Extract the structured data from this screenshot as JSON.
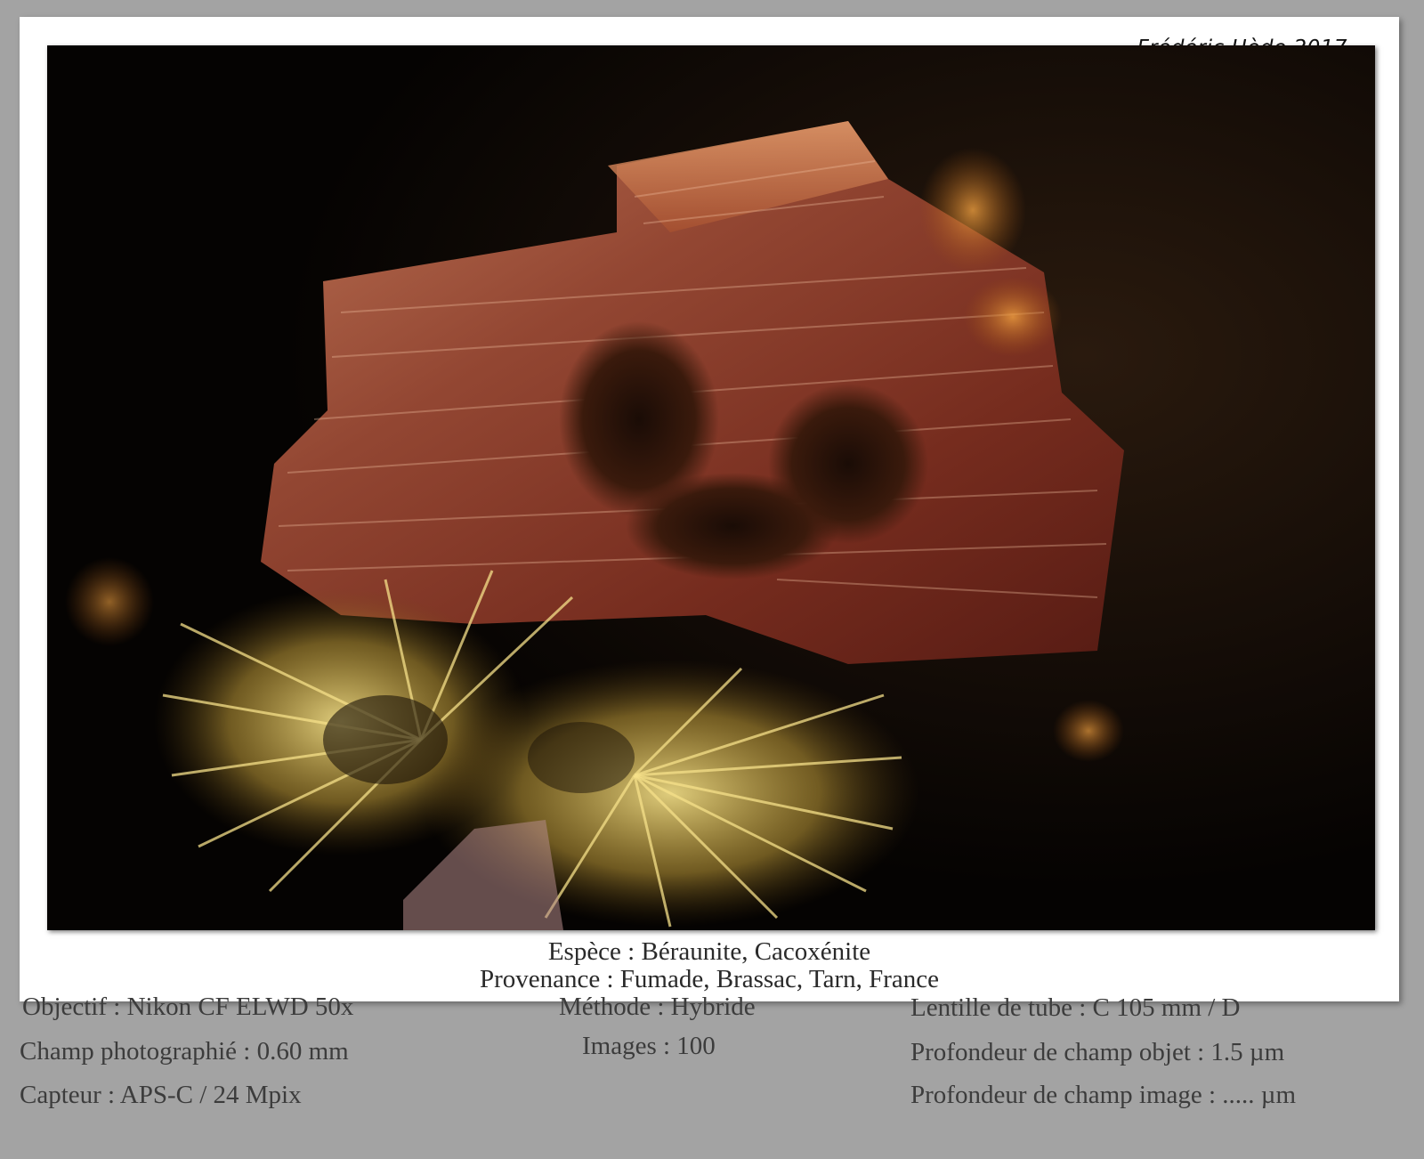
{
  "credit": "Frédéric Hède 2017",
  "caption": {
    "species": "Espèce : Béraunite, Cacoxénite",
    "origin": "Provenance : Fumade, Brassac, Tarn, France"
  },
  "info": {
    "objective": "Objectif : Nikon CF ELWD 50x",
    "field": "Champ photographié : 0.60 mm",
    "sensor": "Capteur : APS-C / 24 Mpix",
    "method": "Méthode : Hybride",
    "images": "Images : 100",
    "tube_lens": "Lentille de tube : C 105 mm / D",
    "dof_object": "Profondeur de champ objet : 1.5 µm",
    "dof_image": "Profondeur de champ image : ..... µm"
  },
  "colors": {
    "background": "#a3a3a3",
    "frame": "#ffffff",
    "crystal_red": "#8a3320",
    "needle_yellow": "#f2d86a"
  }
}
